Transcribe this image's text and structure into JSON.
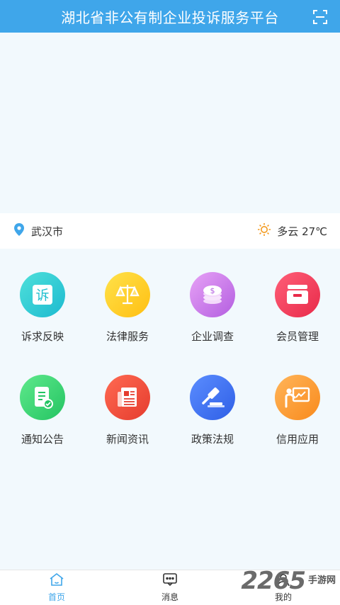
{
  "header": {
    "title": "湖北省非公有制企业投诉服务平台"
  },
  "location": {
    "city": "武汉市"
  },
  "weather": {
    "text": "多云 27℃"
  },
  "grid": {
    "items": [
      {
        "label": "诉求反映",
        "icon": "complaint-icon",
        "glyph": "诉"
      },
      {
        "label": "法律服务",
        "icon": "scale-icon"
      },
      {
        "label": "企业调查",
        "icon": "coins-icon"
      },
      {
        "label": "会员管理",
        "icon": "archive-box-icon"
      },
      {
        "label": "通知公告",
        "icon": "notice-doc-icon"
      },
      {
        "label": "新闻资讯",
        "icon": "newspaper-icon"
      },
      {
        "label": "政策法规",
        "icon": "gavel-icon"
      },
      {
        "label": "信用应用",
        "icon": "presentation-icon"
      }
    ]
  },
  "tabbar": {
    "tabs": [
      {
        "label": "首页",
        "icon": "home-icon",
        "active": true
      },
      {
        "label": "消息",
        "icon": "message-icon",
        "active": false
      },
      {
        "label": "我的",
        "icon": "user-icon",
        "active": false
      }
    ]
  },
  "watermark": {
    "number": "2265",
    "line1": "手游网",
    "line2": ""
  },
  "colors": {
    "header": "#3fa6ea",
    "background": "#f2f9fd",
    "tab_active": "#3fa6ea"
  }
}
